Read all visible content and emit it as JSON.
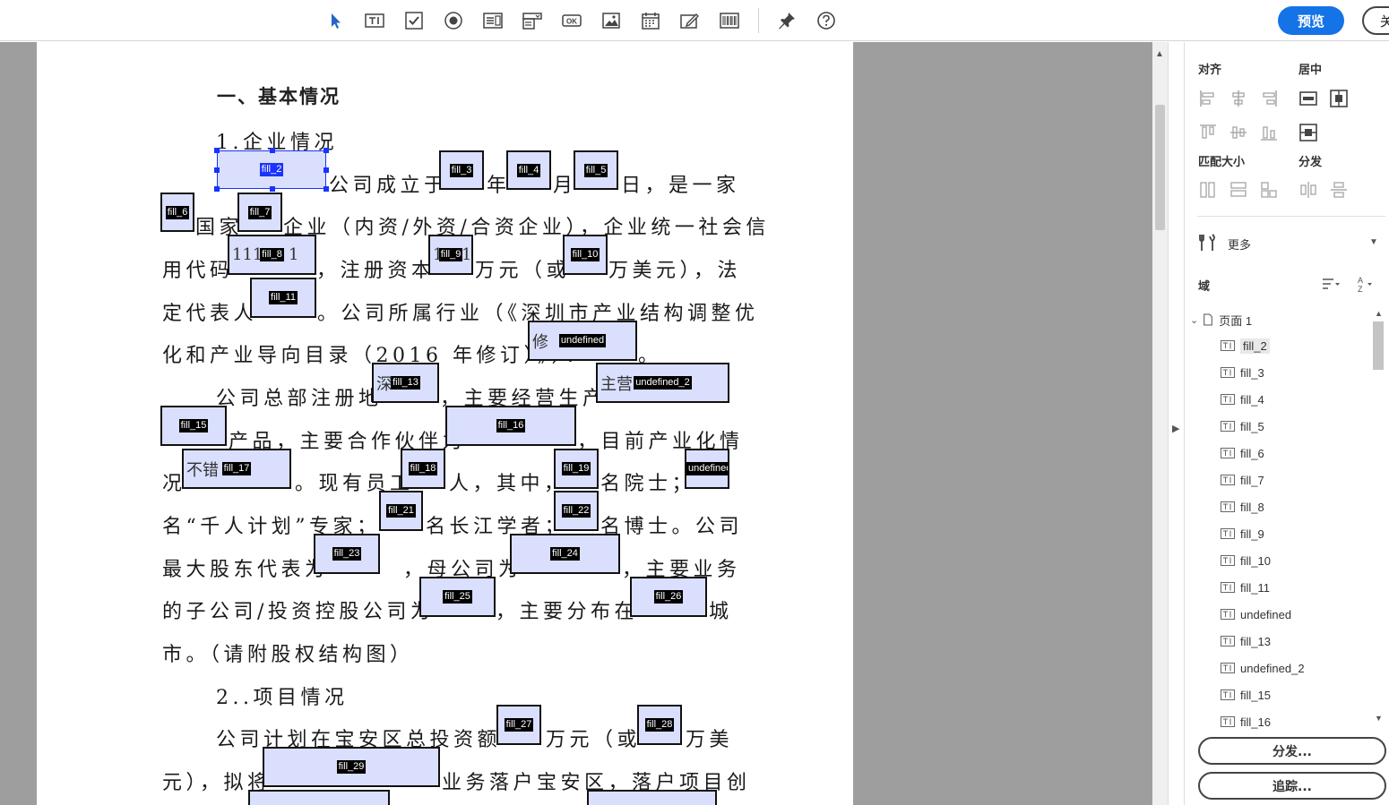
{
  "toolbar": {
    "tools": [
      {
        "name": "select-tool-icon"
      },
      {
        "name": "text-field-tool-icon"
      },
      {
        "name": "checkbox-tool-icon"
      },
      {
        "name": "radio-button-tool-icon"
      },
      {
        "name": "list-box-tool-icon"
      },
      {
        "name": "dropdown-tool-icon"
      },
      {
        "name": "button-tool-icon",
        "label": "OK"
      },
      {
        "name": "image-field-tool-icon"
      },
      {
        "name": "date-field-tool-icon"
      },
      {
        "name": "signature-tool-icon"
      },
      {
        "name": "barcode-tool-icon"
      },
      {
        "name": "pin-icon"
      },
      {
        "name": "help-icon"
      }
    ],
    "preview_label": "预览",
    "close_label": "关"
  },
  "document": {
    "heading": "一、基本情况",
    "lines": [
      "1.企业情况",
      "公司成立于",
      "年",
      "月",
      "日，是一家",
      "国家",
      "企业（内资/外资/合资企业），企业统一社会信",
      "用代码",
      "，注册资本",
      "万元（或",
      "万美元），法",
      "定代表人",
      "。公司所属行业（《深圳市产业结构调整优",
      "化和产业导向目录（2016 年修订）》）：",
      "。",
      "公司总部注册地",
      "，主要经营生产",
      "产品，主要合作伙伴为",
      "，目前产业化情",
      "况",
      "。现有员工",
      "人，其中，",
      "名院士；",
      "名“千人计划”专家；",
      "名长江学者；",
      "名博士。公司",
      "最大股东代表为",
      "，母公司为",
      "，主要业务",
      "的子公司/投资控股公司为",
      "，主要分布在",
      "城",
      "市。（请附股权结构图）",
      "2..项目情况",
      "公司计划在宝安区总投资额",
      "万元（或",
      "万美",
      "元），拟将",
      "业务落户宝安区，落户项目创"
    ],
    "fields": {
      "fill_2": "fill_2",
      "fill_3": "fill_3",
      "fill_4": "fill_4",
      "fill_5": "fill_5",
      "fill_6": "fill_6",
      "fill_7": "fill_7",
      "fill_8": "fill_8",
      "fill_8_value": "111",
      "fill_8_value2": "1",
      "fill_9": "fill_9",
      "fill_9_value": "1",
      "fill_9_value2": "1",
      "fill_10": "fill_10",
      "fill_11": "fill_11",
      "undefined": "undefined",
      "undefined_value": "修",
      "fill_13": "fill_13",
      "fill_13_value": "深",
      "undefined_2": "undefined_2",
      "undefined_2_value": "主营",
      "fill_15": "fill_15",
      "fill_16": "fill_16",
      "fill_17": "fill_17",
      "fill_17_value": "不错",
      "fill_18": "fill_18",
      "fill_19": "fill_19",
      "fill_20": "undefined",
      "fill_21": "fill_21",
      "fill_22": "fill_22",
      "fill_23": "fill_23",
      "fill_24": "fill_24",
      "fill_25": "fill_25",
      "fill_26": "fill_26",
      "fill_27": "fill_27",
      "fill_28": "fill_28",
      "fill_29": "fill_29"
    }
  },
  "panel": {
    "align_label": "对齐",
    "center_label": "居中",
    "match_size_label": "匹配大小",
    "distribute_label": "分发",
    "more_label": "更多",
    "fields_label": "域",
    "tree_root": "页面 1",
    "tree_items": [
      "fill_2",
      "fill_3",
      "fill_4",
      "fill_5",
      "fill_6",
      "fill_7",
      "fill_8",
      "fill_9",
      "fill_10",
      "fill_11",
      "undefined",
      "fill_13",
      "undefined_2",
      "fill_15",
      "fill_16"
    ],
    "distribute_button": "分发...",
    "track_button": "追踪..."
  },
  "colors": {
    "accent": "#1473e6",
    "field_fill": "#d9dffd",
    "selection": "#1a33ff",
    "doc_background": "#9e9e9e"
  }
}
